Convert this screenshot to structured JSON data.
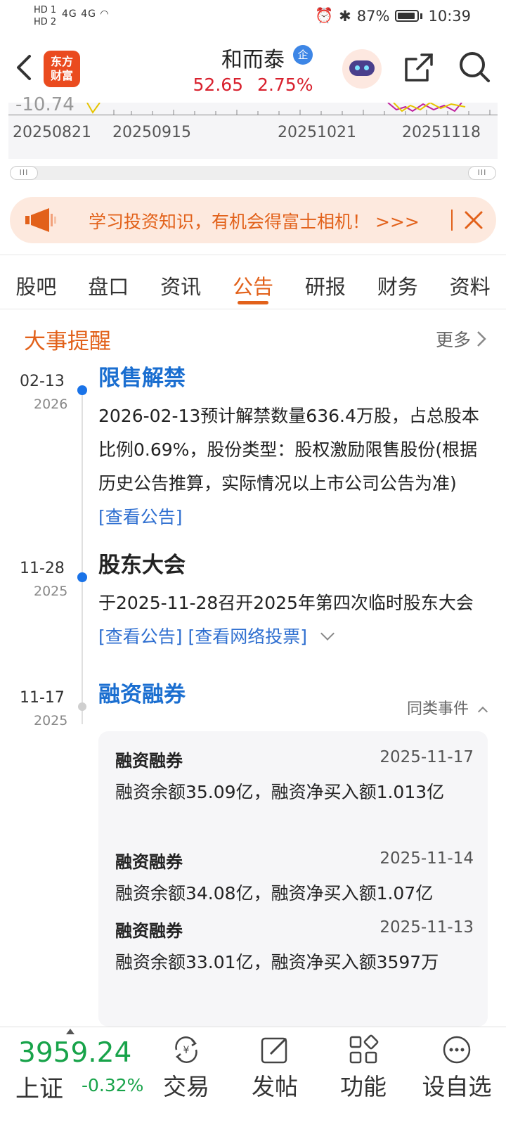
{
  "status_bar": {
    "sim1": "HD 1",
    "sim2": "HD 2",
    "network": "4G 4G",
    "battery": "87%",
    "time": "10:39"
  },
  "header": {
    "logo_line1": "东方",
    "logo_line2": "财富",
    "stock_name": "和而泰",
    "badge": "企",
    "price": "52.65",
    "change_pct": "2.75%"
  },
  "chart_strip": {
    "axis_value": "-10.74",
    "dates": [
      "20250821",
      "20250915",
      "20251021",
      "20251118"
    ]
  },
  "banner": {
    "text": "学习投资知识，有机会得富士相机！ >>>"
  },
  "tabs": [
    "股吧",
    "盘口",
    "资讯",
    "公告",
    "研报",
    "财务",
    "资料"
  ],
  "active_tab": "公告",
  "section": {
    "title": "大事提醒",
    "more": "更多"
  },
  "events": [
    {
      "date": "02-13",
      "year": "2026",
      "title": "限售解禁",
      "body": "2026-02-13预计解禁数量636.4万股，占总股本比例0.69%，股份类型：股权激励限售股份(根据历史公告推算，实际情况以上市公司公告为准)",
      "link1": "[查看公告]"
    },
    {
      "date": "11-28",
      "year": "2025",
      "title": "股东大会",
      "body": "于2025-11-28召开2025年第四次临时股东大会",
      "link1": "[查看公告]",
      "link2": "[查看网络投票]"
    },
    {
      "date": "11-17",
      "year": "2025",
      "title": "融资融券",
      "same_events": "同类事件"
    }
  ],
  "margin_records": [
    {
      "title": "融资融券",
      "date": "2025-11-17",
      "text": "融资余额35.09亿，融资净买入额1.013亿"
    },
    {
      "title": "融资融券",
      "date": "2025-11-14",
      "text": "融资余额34.08亿，融资净买入额1.07亿"
    },
    {
      "title": "融资融券",
      "date": "2025-11-13",
      "text": "融资余额33.01亿，融资净买入额3597万"
    }
  ],
  "bottom_bar": {
    "index_value": "3959.24",
    "index_name": "上证",
    "index_change": "-0.32%",
    "nav": [
      "交易",
      "发帖",
      "功能",
      "设自选"
    ]
  },
  "colors": {
    "accent": "#e2611a",
    "link": "#2f6fd0",
    "price_up": "#d8202d",
    "price_down": "#18a34a"
  }
}
